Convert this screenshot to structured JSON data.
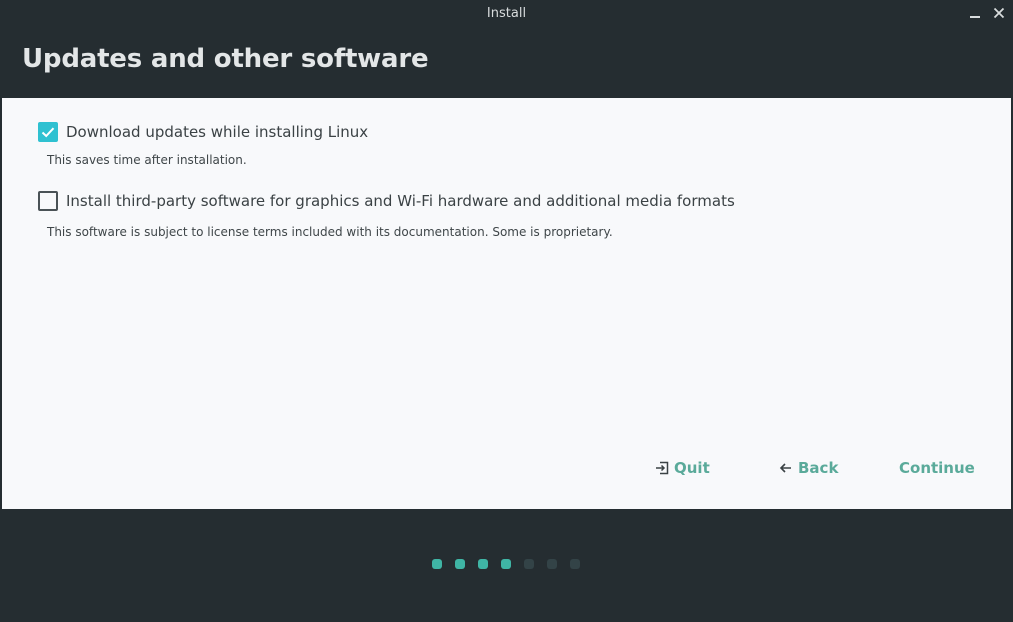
{
  "window": {
    "title": "Install"
  },
  "header": {
    "title": "Updates and other software"
  },
  "options": [
    {
      "label": "Download updates while installing Linux",
      "description": "This saves time after installation.",
      "checked": true
    },
    {
      "label": "Install third-party software for graphics and Wi-Fi hardware and additional media formats",
      "description": "This software is subject to license terms included with its documentation. Some is proprietary.",
      "checked": false
    }
  ],
  "buttons": {
    "quit": "Quit",
    "back": "Back",
    "continue": "Continue"
  },
  "progress": {
    "total_steps": 7,
    "completed_steps": 4
  },
  "colors": {
    "accent": "#2fc1d1",
    "button_text": "#5aaa9a",
    "dot_active": "#3fb5a5",
    "dot_inactive": "#334347",
    "background": "#252d31"
  }
}
